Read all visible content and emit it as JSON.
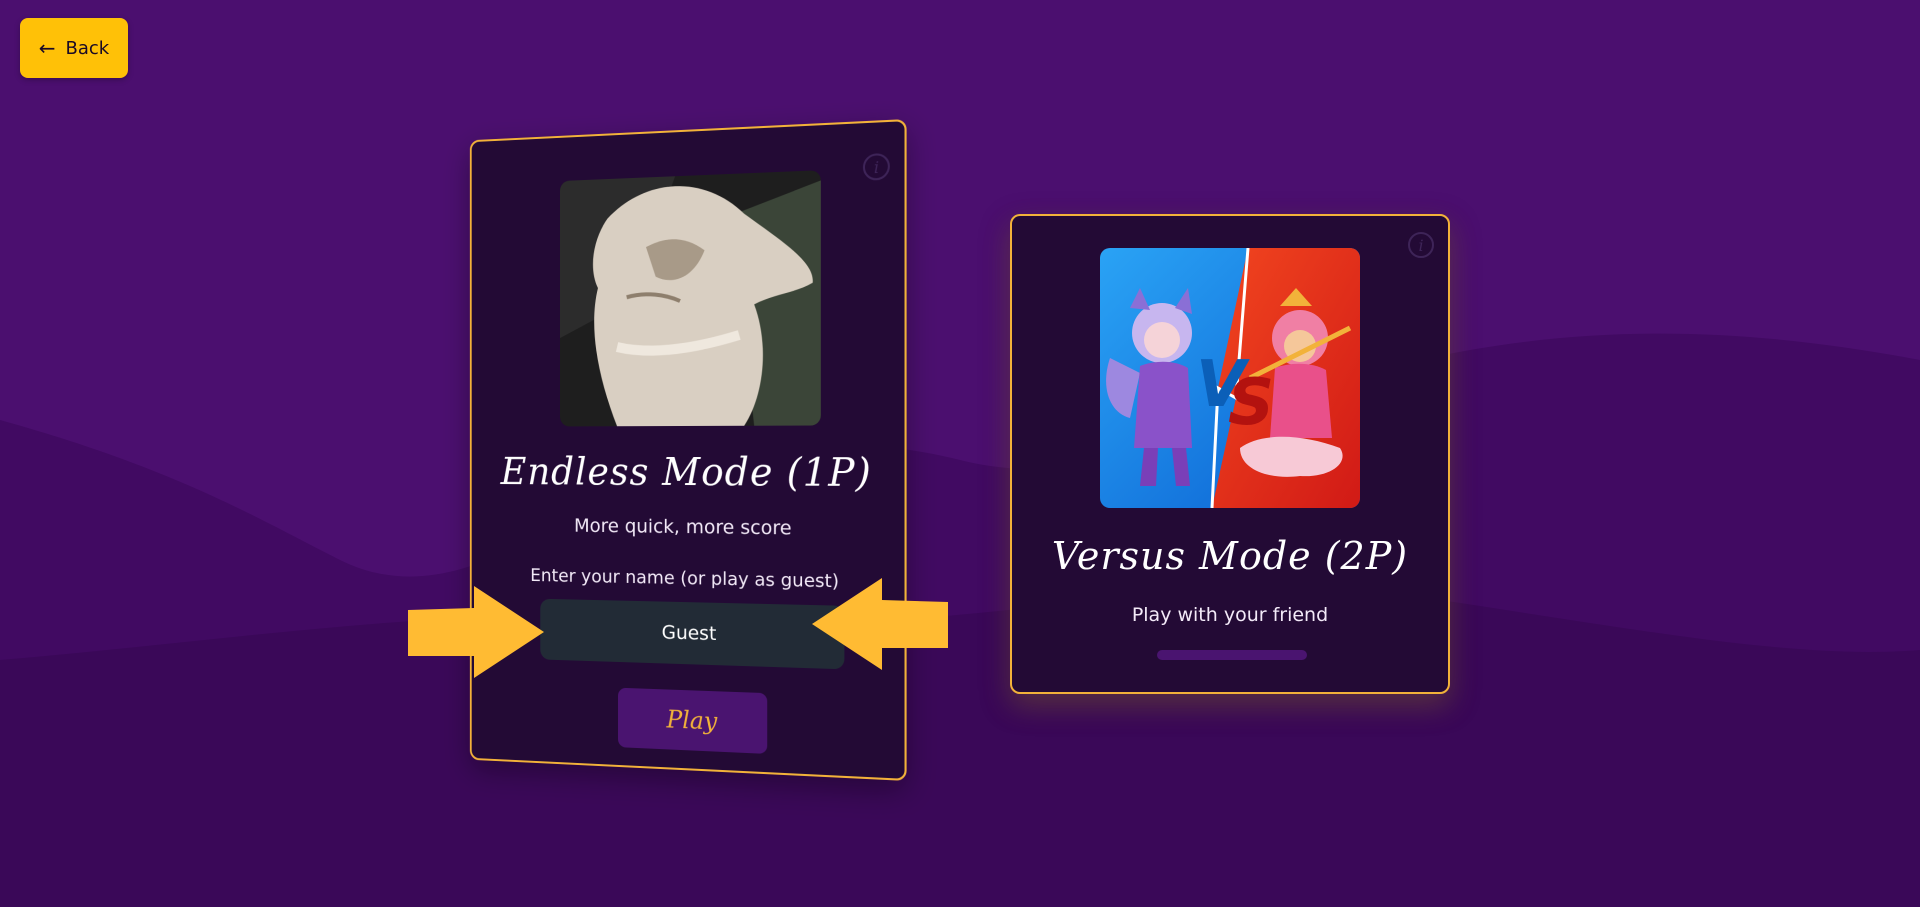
{
  "header": {
    "back_icon": "arrow-left-icon",
    "back_label": "Back"
  },
  "endless_mode": {
    "title": "Endless Mode (1P)",
    "subtitle": "More quick, more score",
    "name_label": "Enter your name (or play as guest)",
    "name_value": "Guest",
    "play_label": "Play",
    "image_icon": "cat-image",
    "info_icon": "info-icon"
  },
  "versus_mode": {
    "title": "Versus Mode (2P)",
    "subtitle": "Play with your friend",
    "image_icon": "versus-characters-image",
    "info_icon": "info-icon",
    "loading_progress": 1.0
  },
  "colors": {
    "background": "#4b0f6f",
    "card_background": "#230a35",
    "card_border": "#f2b23a",
    "accent_yellow": "#ffc107",
    "input_background": "#222b36",
    "play_button_background": "#4a1470",
    "arrow_color": "#ffbb33"
  }
}
